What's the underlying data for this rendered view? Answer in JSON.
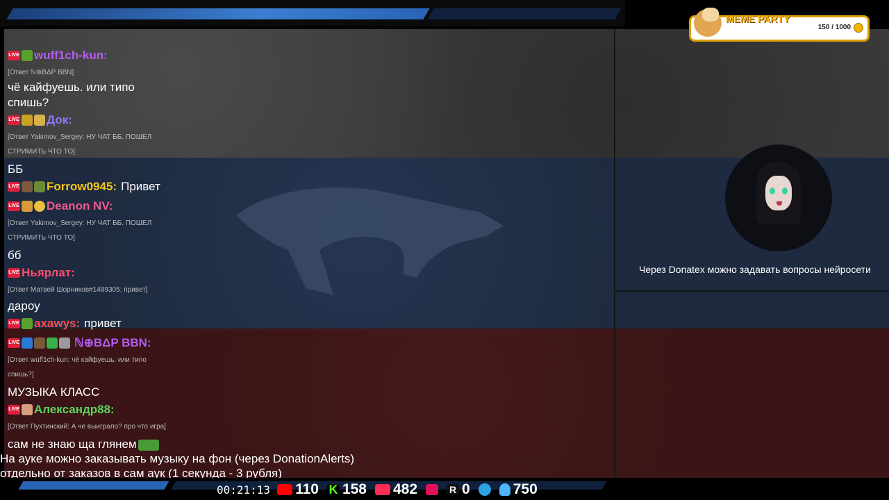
{
  "overlay": {
    "meme_party": {
      "title": "MEME PARTY",
      "progress_text": "150 / 1000",
      "progress": 0.15
    },
    "donatex_notice": "Через Donatex можно задавать вопросы нейросети",
    "auk_notice_line1": "На ауке можно заказывать музыку на фон (через DonationAlerts)",
    "auk_notice_line2": "отдельно от заказов в сам аук (1 секунда - 3 рубля)"
  },
  "chat": {
    "messages": [
      {
        "nick": "wuff1ch-kun:",
        "nick_color": "#b45cf0",
        "reply": "[Ответ ℕ⊕BΔP BBN]",
        "text": "чё кайфуешь. или типо спишь?"
      },
      {
        "nick": "Док:",
        "nick_color": "#8a7cf5",
        "reply": "[Ответ Yakimov_Sergey: НУ ЧАТ ББ. ПОШЕЛ СТРИМИТЬ ЧТО ТО]",
        "text": "ББ"
      },
      {
        "nick": "Forrow0945:",
        "nick_color": "#f5c518",
        "text": "Привет"
      },
      {
        "nick": "Deanon NV:",
        "nick_color": "#f05a8c",
        "reply": "[Ответ Yakimov_Sergey: НУ ЧАТ ББ. ПОШЕЛ СТРИМИТЬ ЧТО ТО]",
        "text": "бб"
      },
      {
        "nick": "Ньярлат:",
        "nick_color": "#ff4d6d",
        "reply": "[Ответ Матвей Шорников#1489305: привет]",
        "text": "дароу"
      },
      {
        "nick": "axawys:",
        "nick_color": "#ff4d4d",
        "text": "привет"
      },
      {
        "nick": "ℕ⊕BΔP BBN:",
        "nick_color": "#b45cf0",
        "reply": "[Ответ wuff1ch-kun: чё кайфуешь. или типо спишь?]",
        "text": "МУЗЫКА КЛАСС"
      },
      {
        "nick": "Александр88:",
        "nick_color": "#5cd65c",
        "reply": "[Ответ Пухтинский: А че выиграло? про что игра]",
        "text": "сам не знаю ща глянем"
      }
    ]
  },
  "stats": {
    "uptime": "00:21:13",
    "youtube": "110",
    "kick": "158",
    "vk_live": "482",
    "rutube": "",
    "r_count": "0",
    "telegram": "",
    "total": "750"
  },
  "colors": {
    "live_badge": "#e01f3d",
    "youtube": "#ff0000",
    "kick": "#53fc18",
    "vk_live": "#ff2d55",
    "rutube": "#e1105c",
    "telegram": "#2aa3e0",
    "total": "#4fb5ff"
  }
}
